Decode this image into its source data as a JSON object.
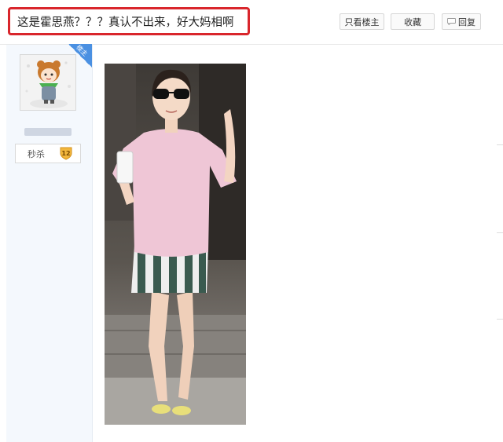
{
  "post": {
    "title": "这是霍思燕？？？真认不出来，好大妈相啊"
  },
  "toolbar": {
    "only_op_label": "只看楼主",
    "favorite_label": "收藏",
    "reply_label": "回复"
  },
  "author": {
    "badge_label": "楼主",
    "rank_label": "秒杀",
    "level": "12"
  },
  "colors": {
    "highlight_border": "#d9262c",
    "sidebar_bg": "#f4f8fd",
    "badge_blue": "#4a90e2",
    "level_gold": "#f2b63c"
  },
  "icons": {
    "reply": "speech-bubble-icon",
    "level": "level-shield-icon"
  }
}
